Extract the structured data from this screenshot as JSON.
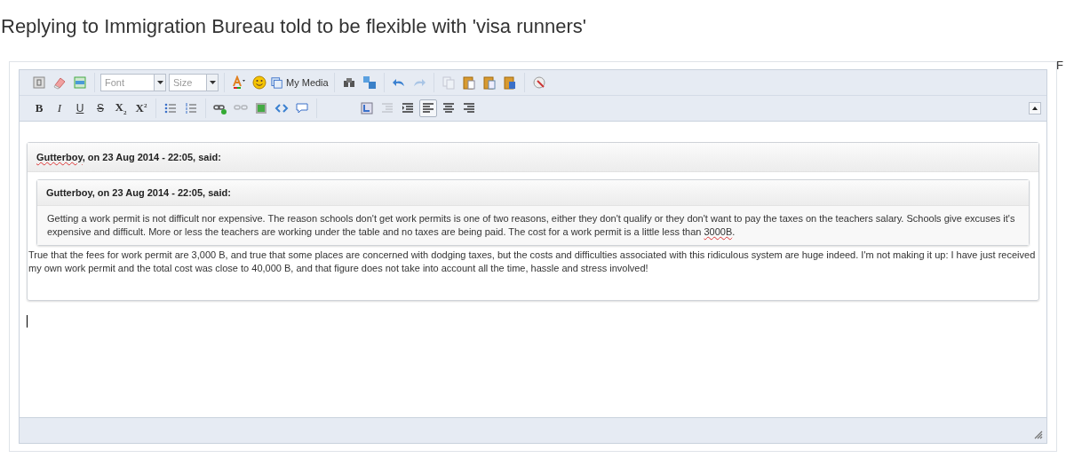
{
  "page_title": "Replying to Immigration Bureau told to be flexible with 'visa runners'",
  "edge_text": "F",
  "toolbar": {
    "rows": [
      [
        [
          {
            "kind": "icon",
            "disabled": false
          },
          {
            "kind": "icon",
            "disabled": false
          },
          {
            "kind": "icon",
            "disabled": false
          }
        ],
        [
          {
            "kind": "dropdown",
            "placeholder": "Font"
          },
          {
            "kind": "dropdown",
            "placeholder": "Size"
          }
        ],
        [
          {
            "kind": "icon",
            "disabled": false
          },
          {
            "kind": "icon",
            "disabled": false
          },
          {
            "kind": "media",
            "label": "My Media"
          }
        ],
        [
          {
            "kind": "icon",
            "disabled": false
          },
          {
            "kind": "icon",
            "disabled": false
          }
        ],
        [
          {
            "kind": "icon",
            "disabled": false
          },
          {
            "kind": "icon",
            "disabled": true
          }
        ],
        [
          {
            "kind": "icon",
            "disabled": true
          },
          {
            "kind": "icon",
            "disabled": false
          },
          {
            "kind": "icon",
            "disabled": false
          },
          {
            "kind": "icon",
            "disabled": false
          }
        ],
        [
          {
            "kind": "icon",
            "disabled": false
          }
        ]
      ],
      [
        [
          {
            "kind": "glyph",
            "label": "B"
          },
          {
            "kind": "glyph",
            "label": "I"
          },
          {
            "kind": "glyph",
            "label": "U"
          },
          {
            "kind": "glyph",
            "label": "S"
          },
          {
            "kind": "glyph",
            "label": "X$_{2}$"
          },
          {
            "kind": "glyph",
            "label": "X$^{2}$"
          }
        ],
        [
          {
            "kind": "icon",
            "disabled": false
          },
          {
            "kind": "icon",
            "disabled": false
          }
        ],
        [
          {
            "kind": "icon",
            "disabled": false
          },
          {
            "kind": "icon",
            "disabled": true
          },
          {
            "kind": "icon",
            "disabled": false
          },
          {
            "kind": "icon",
            "disabled": false
          },
          {
            "kind": "icon",
            "disabled": false
          }
        ],
        [
          {
            "kind": "icon",
            "disabled": false,
            "selected": false
          },
          {
            "kind": "icon",
            "disabled": true,
            "selected": false
          },
          {
            "kind": "icon",
            "disabled": false,
            "selected": false
          },
          {
            "kind": "icon",
            "disabled": false,
            "selected": true
          },
          {
            "kind": "icon",
            "disabled": false,
            "selected": false
          },
          {
            "kind": "icon",
            "disabled": false,
            "selected": false
          }
        ]
      ]
    ]
  },
  "quote": {
    "header": [
      {
        "text": "Gutterboy",
        "misspelled": true
      },
      {
        "text": ", on 23 Aug 2014 - 22:05, said:"
      }
    ],
    "nested": {
      "header": [
        {
          "text": "Gutterboy, on 23 Aug 2014 - 22:05, said:"
        }
      ],
      "body": [
        {
          "text": "Getting a work permit is not difficult nor expensive. The reason schools don't get work permits is one of two reasons, either they don't qualify or they don't want to pay the taxes on the teachers salary. Schools give excuses it's expensive and difficult. More or less the teachers are working under the table and no taxes are being paid. The cost for a work permit is a little less than "
        },
        {
          "text": "3000B",
          "misspelled": true
        },
        {
          "text": "."
        }
      ]
    },
    "body": [
      {
        "text": "True that the fees for work permit are 3,000 B, and true that some places are concerned with dodging taxes, but the costs and difficulties associated with this ridiculous system are huge indeed. I'm not making it up: I have just received my own work permit and the total cost was close to 40,000 B, and that figure does not take into account all the time, hassle and stress involved!"
      }
    ]
  }
}
